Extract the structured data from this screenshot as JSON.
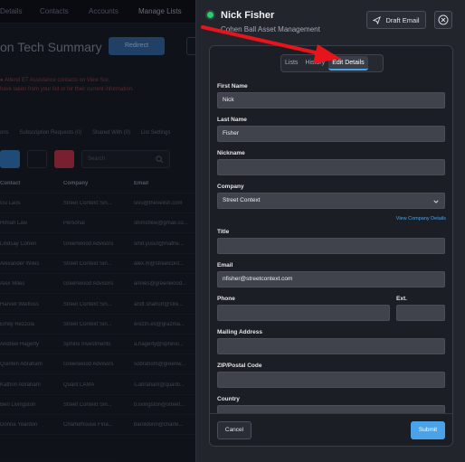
{
  "background": {
    "nav_items": [
      "Details",
      "Contacts",
      "Accounts",
      "Manage Lists"
    ],
    "page_title": "on Tech Summary",
    "primary_button": "Redirect",
    "alert_lines": [
      "● Attend ET Assistance contacts on View Sor.",
      "have taken from your list or for their current information."
    ],
    "tabs": [
      "ons",
      "Subscription Requests (0)",
      "Shared With (0)",
      "List Settings"
    ],
    "search_placeholder": "Search",
    "table_headers": [
      "Contact",
      "Company",
      "Email"
    ],
    "table_rows": [
      [
        "Gu Laos",
        "Street Context Sin...",
        "sivu@thevelish.com"
      ],
      [
        "Himah Law",
        "Personal",
        "shimsflew@gmail.co..."
      ],
      [
        "Lindsay Cohen",
        "Greenwood Advisors",
        "smit.yusuf@mathe..."
      ],
      [
        "Alexander Wiles",
        "Street Context Sin...",
        "alex.m@streetcont..."
      ],
      [
        "Alex Miles",
        "Greenwood Advisors",
        "amiles@greenwood..."
      ],
      [
        "Harvell Weifluss",
        "Street Context Sin...",
        "andt.shahurt@stre..."
      ],
      [
        "Emily Rezzola",
        "Street Context Sin...",
        "ereztn.es@grazma..."
      ],
      [
        "Andrew Hagerty",
        "Sphinx Investments",
        "a.hagerty@sphinxi..."
      ],
      [
        "Quinten Abraham",
        "Greenwood Advisors",
        "sobrahom@greenw..."
      ],
      [
        "Kathrin Abraham",
        "Quant LAMA",
        "s.abraham@quanti..."
      ],
      [
        "Ben Livingston",
        "Street Context Sin...",
        "b.livingston@street..."
      ],
      [
        "Donna Yeardon",
        "Charterhouse Fina...",
        "baroldonn@charte..."
      ]
    ]
  },
  "drawer": {
    "status_color": "#2ecc71",
    "contact_name": "Nick Fisher",
    "company_name": "Cohen Ball Asset Management",
    "draft_email_label": "Draft Email",
    "close_icon": "close-icon",
    "tabs": [
      {
        "label": "Lists"
      },
      {
        "label": "History"
      },
      {
        "label": "Edit Details",
        "active": true
      }
    ],
    "form": {
      "first_name_label": "First Name",
      "first_name_value": "Nick",
      "last_name_label": "Last Name",
      "last_name_value": "Fisher",
      "nickname_label": "Nickname",
      "nickname_value": "",
      "company_label": "Company",
      "company_value": "Street Context",
      "view_company_link": "View Company Details",
      "title_label": "Title",
      "title_value": "",
      "email_label": "Email",
      "email_value": "nfisher@streetcontext.com",
      "phone_label": "Phone",
      "phone_value": "",
      "ext_label": "Ext.",
      "ext_value": "",
      "mailing_label": "Mailing Address",
      "mailing_value": "",
      "zip_label": "ZIP/Postal Code",
      "zip_value": "",
      "country_label": "Country"
    },
    "cancel_label": "Cancel",
    "submit_label": "Submit",
    "accent_color": "#4aa3e8"
  },
  "annotation": {
    "arrow_color": "#e8141c"
  }
}
